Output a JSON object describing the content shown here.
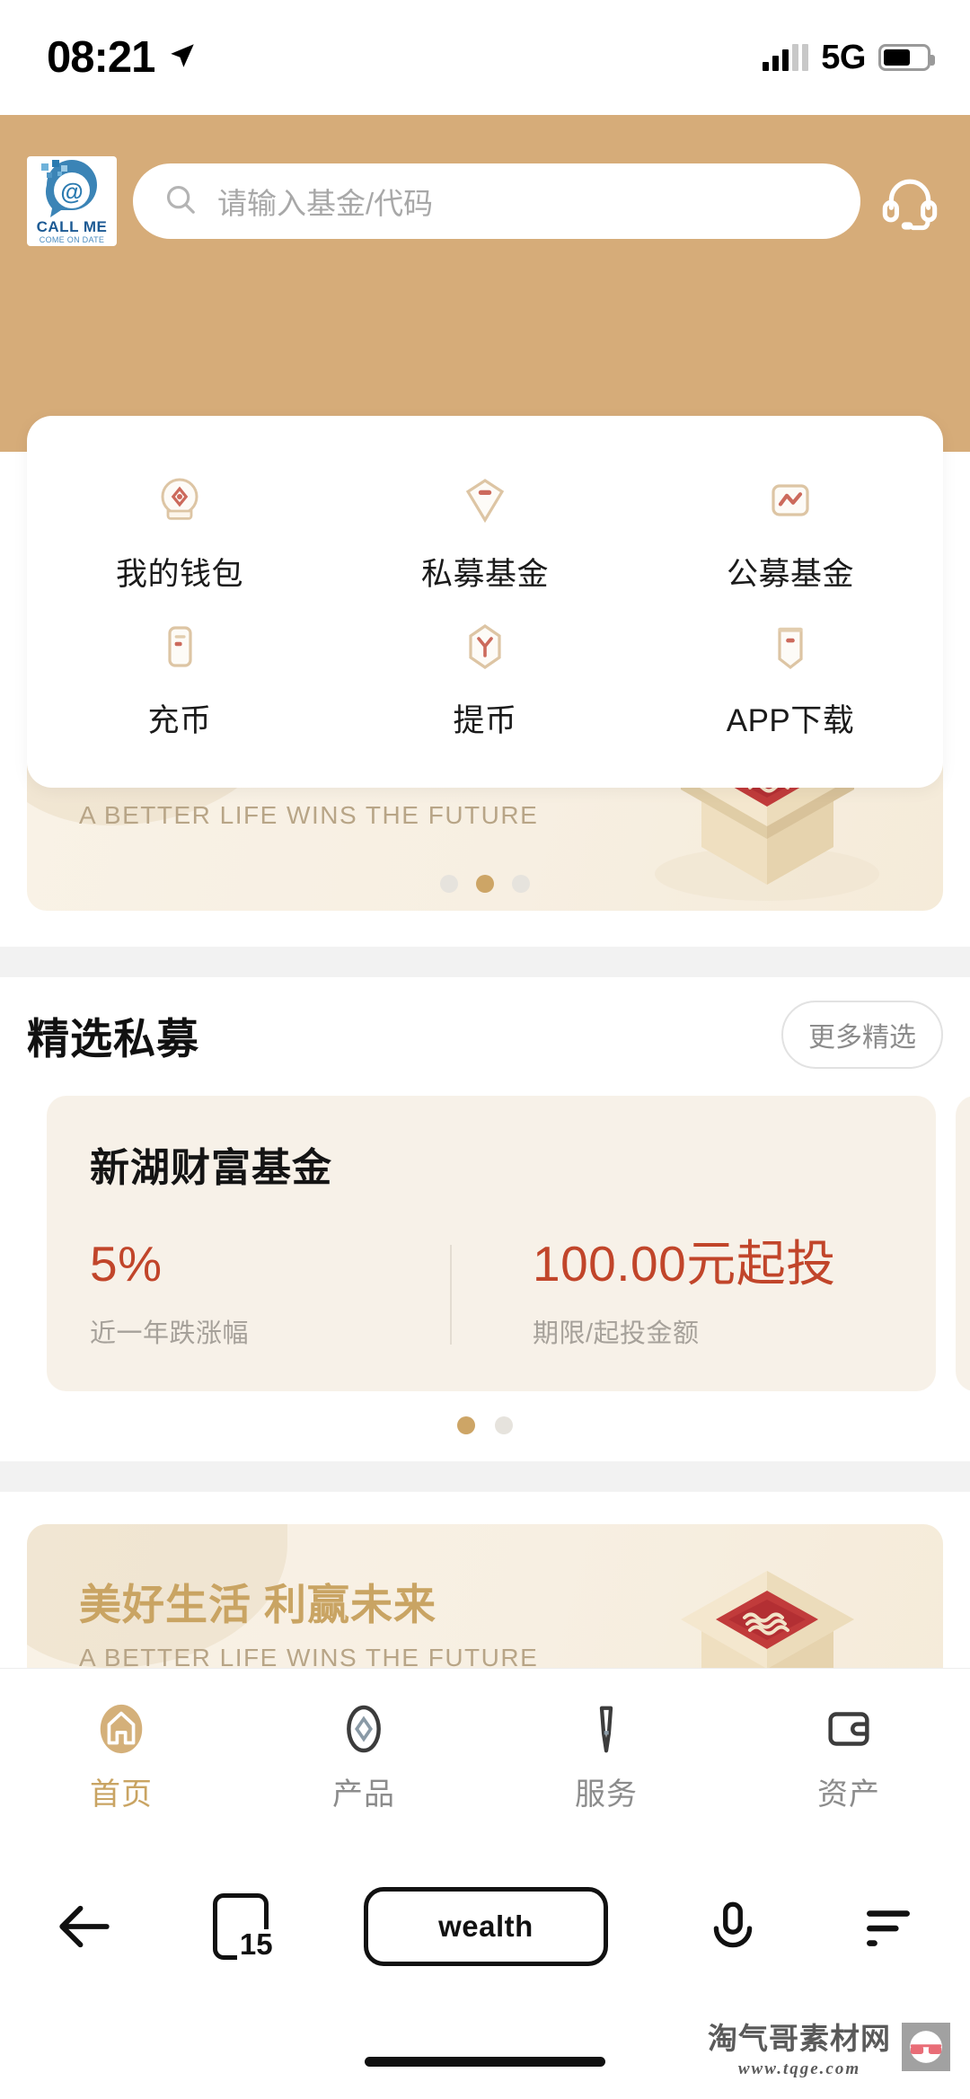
{
  "status_bar": {
    "time": "08:21",
    "location_icon": "location-arrow-icon",
    "network": "5G",
    "signal_icon": "signal-bars-icon",
    "battery_icon": "battery-icon"
  },
  "header": {
    "logo": {
      "title": "CALL ME",
      "subtitle": "COME ON DATE",
      "icon": "at-sign-chat-logo"
    },
    "search": {
      "placeholder": "请输入基金/代码",
      "value": "",
      "icon": "search-icon"
    },
    "support_icon": "headset-icon",
    "background_color": "#d6ac79"
  },
  "quick_menu": {
    "items": [
      {
        "label": "我的钱包",
        "icon": "wallet-icon"
      },
      {
        "label": "私募基金",
        "icon": "shield-private-fund-icon"
      },
      {
        "label": "公募基金",
        "icon": "chart-public-fund-icon"
      },
      {
        "label": "充币",
        "icon": "deposit-phone-icon"
      },
      {
        "label": "提币",
        "icon": "withdraw-icon"
      },
      {
        "label": "APP下载",
        "icon": "app-download-banner-icon"
      }
    ]
  },
  "banner": {
    "title_cn": "美好生活 利赢未来",
    "title_en": "A BETTER LIFE WINS THE FUTURE",
    "dots": 3,
    "active_dot": 1,
    "art_icon": "isometric-gift-box-seal-icon"
  },
  "banner2": {
    "title_cn": "美好生活 利赢未来",
    "title_en": "A BETTER LIFE WINS THE FUTURE",
    "art_icon": "isometric-gift-box-seal-icon"
  },
  "featured": {
    "title": "精选私募",
    "more_label": "更多精选",
    "cards": [
      {
        "name": "新湖财富基金",
        "return_value": "5%",
        "return_label": "近一年跌涨幅",
        "amount_value": "100.00元起投",
        "amount_label": "期限/起投金额"
      }
    ],
    "dots": 2,
    "active_dot": 0,
    "accent_color": "#c1452a"
  },
  "tabbar": {
    "items": [
      {
        "label": "首页",
        "icon": "home-icon",
        "active": true
      },
      {
        "label": "产品",
        "icon": "product-diamond-icon",
        "active": false
      },
      {
        "label": "服务",
        "icon": "service-tie-icon",
        "active": false
      },
      {
        "label": "资产",
        "icon": "assets-wallet-icon",
        "active": false
      }
    ],
    "active_color": "#c9a463"
  },
  "browser_bar": {
    "back_icon": "back-arrow-icon",
    "tab_count": "15",
    "tab_icon": "tab-count-icon",
    "url": "wealth",
    "mic_icon": "microphone-icon",
    "menu_icon": "menu-icon"
  },
  "watermark": {
    "name": "淘气哥素材网",
    "url": "www.tqge.com",
    "logo_icon": "glasses-logo-icon"
  }
}
